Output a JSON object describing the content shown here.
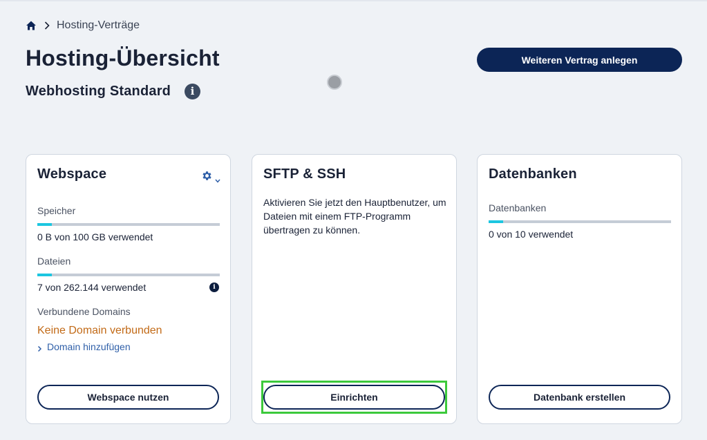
{
  "breadcrumb": {
    "label": "Hosting-Verträge"
  },
  "header": {
    "title": "Hosting-Übersicht",
    "subtitle": "Webhosting Standard",
    "primary_button": "Weiteren Vertrag anlegen"
  },
  "cards": {
    "webspace": {
      "title": "Webspace",
      "storage_label": "Speicher",
      "storage_usage": 0.08,
      "storage_value": "0 B von 100 GB verwendet",
      "files_label": "Dateien",
      "files_usage": 0.08,
      "files_value": "7 von 262.144 verwendet",
      "domains_label": "Verbundene Domains",
      "no_domain": "Keine Domain verbunden",
      "add_domain": "Domain hinzufügen",
      "button": "Webspace nutzen"
    },
    "sftp": {
      "title": "SFTP & SSH",
      "description": "Aktivieren Sie jetzt den Hauptbenutzer, um Dateien mit einem FTP-Programm übertragen zu können.",
      "button": "Einrichten"
    },
    "databases": {
      "title": "Datenbanken",
      "db_label": "Datenbanken",
      "db_usage": 0.08,
      "db_value": "0 von 10 verwendet",
      "button": "Datenbank erstellen"
    }
  },
  "colors": {
    "primary": "#0c2556",
    "accent_bar": "#1cc6e0",
    "warning_text": "#c26a17",
    "link": "#2f5fa8",
    "highlight": "#3cc93c"
  },
  "icons": [
    "home-icon",
    "chevron-right-icon",
    "info-icon",
    "gear-icon",
    "chevron-down-icon",
    "loading-spinner-icon"
  ]
}
